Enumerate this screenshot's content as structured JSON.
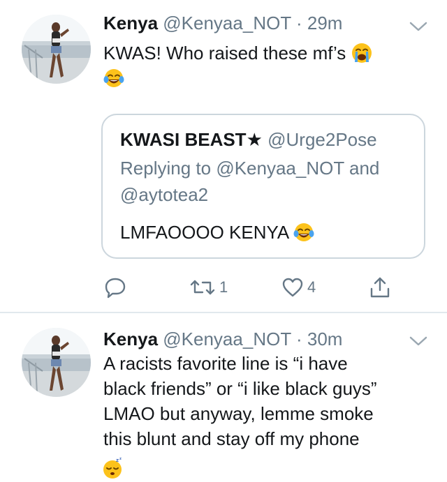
{
  "tweets": [
    {
      "author_name": "Kenya",
      "handle": "@Kenyaa_NOT",
      "separator": "·",
      "time": "29m",
      "text": "KWAS! Who raised these mf’s",
      "emojis": [
        "loudly-crying-face",
        "face-with-tears-of-joy"
      ],
      "quoted": {
        "author_name": "KWASI BEAST★",
        "handle": "@Urge2Pose",
        "replying_prefix": "Replying to",
        "replying_to_1": "@Kenyaa_NOT",
        "replying_and": "and",
        "replying_to_2": "@aytotea2",
        "text": "LMFAOOOO KENYA",
        "emoji": "face-with-tears-of-joy"
      },
      "actions": {
        "reply_icon": "reply-icon",
        "retweet_icon": "retweet-icon",
        "retweet_count": "1",
        "like_icon": "heart-icon",
        "like_count": "4",
        "share_icon": "share-icon"
      }
    },
    {
      "author_name": "Kenya",
      "handle": "@Kenyaa_NOT",
      "separator": "·",
      "time": "30m",
      "text_lines": [
        "A racists favorite line is “i have",
        "black friends” or “i like black guys”",
        "LMAO but anyway, lemme smoke",
        "this blunt and stay off my phone"
      ],
      "emoji": "sleeping-face"
    }
  ],
  "colors": {
    "text": "#14171a",
    "secondary": "#657786",
    "border": "#ccd6dd",
    "divider": "#e1e8ed"
  }
}
